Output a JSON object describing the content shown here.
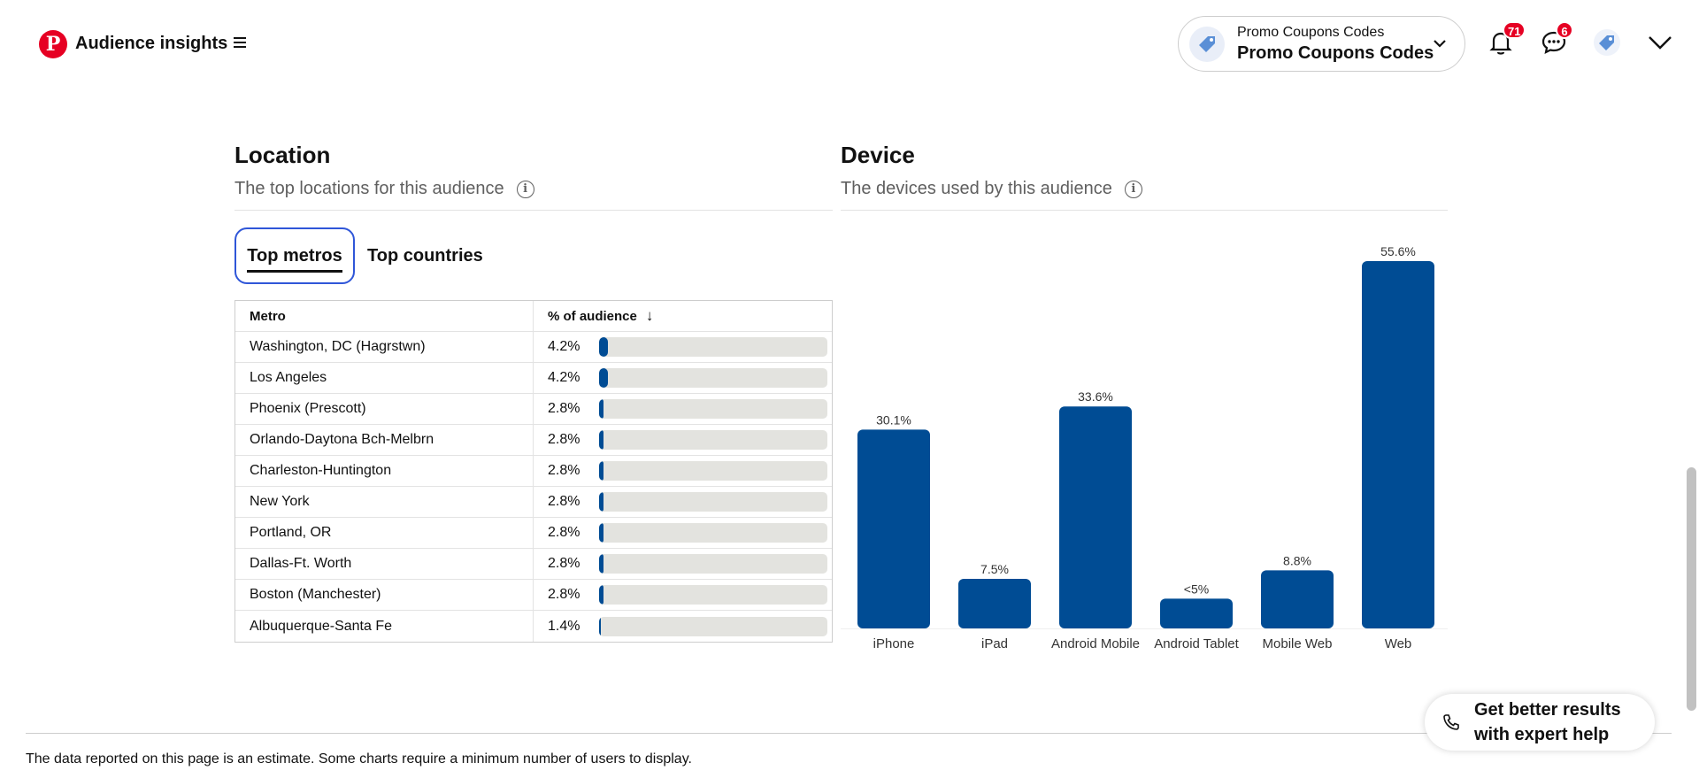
{
  "header": {
    "logo_letter": "P",
    "app_title": "Audience insights",
    "account": {
      "small_label": "Promo Coupons Codes",
      "name": "Promo Coupons Codes"
    },
    "notifications_count": "71",
    "messages_count": "6"
  },
  "location": {
    "title": "Location",
    "subtitle": "The top locations for this audience",
    "tabs": [
      {
        "label": "Top metros",
        "active": true
      },
      {
        "label": "Top countries",
        "active": false
      }
    ],
    "table": {
      "headers": [
        "Metro",
        "% of audience"
      ],
      "rows": [
        {
          "metro": "Washington, DC (Hagrstwn)",
          "pct": "4.2%",
          "value": 4.2
        },
        {
          "metro": "Los Angeles",
          "pct": "4.2%",
          "value": 4.2
        },
        {
          "metro": "Phoenix (Prescott)",
          "pct": "2.8%",
          "value": 2.8
        },
        {
          "metro": "Orlando-Daytona Bch-Melbrn",
          "pct": "2.8%",
          "value": 2.8
        },
        {
          "metro": "Charleston-Huntington",
          "pct": "2.8%",
          "value": 2.8
        },
        {
          "metro": "New York",
          "pct": "2.8%",
          "value": 2.8
        },
        {
          "metro": "Portland, OR",
          "pct": "2.8%",
          "value": 2.8
        },
        {
          "metro": "Dallas-Ft. Worth",
          "pct": "2.8%",
          "value": 2.8
        },
        {
          "metro": "Boston (Manchester)",
          "pct": "2.8%",
          "value": 2.8
        },
        {
          "metro": "Albuquerque-Santa Fe",
          "pct": "1.4%",
          "value": 1.4
        }
      ]
    }
  },
  "device": {
    "title": "Device",
    "subtitle": "The devices used by this audience"
  },
  "chart_data": {
    "type": "bar",
    "categories": [
      "iPhone",
      "iPad",
      "Android Mobile",
      "Android Tablet",
      "Mobile Web",
      "Web"
    ],
    "values": [
      30.1,
      7.5,
      33.6,
      4.5,
      8.8,
      55.6
    ],
    "labels": [
      "30.1%",
      "7.5%",
      "33.6%",
      "<5%",
      "8.8%",
      "55.6%"
    ],
    "ylim": [
      0,
      55.6
    ],
    "bar_color": "#004c94",
    "grid": false
  },
  "footer": {
    "disclaimer": "The data reported on this page is an estimate. Some charts require a minimum number of users to display.",
    "help_label": "Get better results with expert help"
  },
  "colors": {
    "brand": "#e60023",
    "bar": "#004c94",
    "active_tab_border": "#2f56d8"
  }
}
